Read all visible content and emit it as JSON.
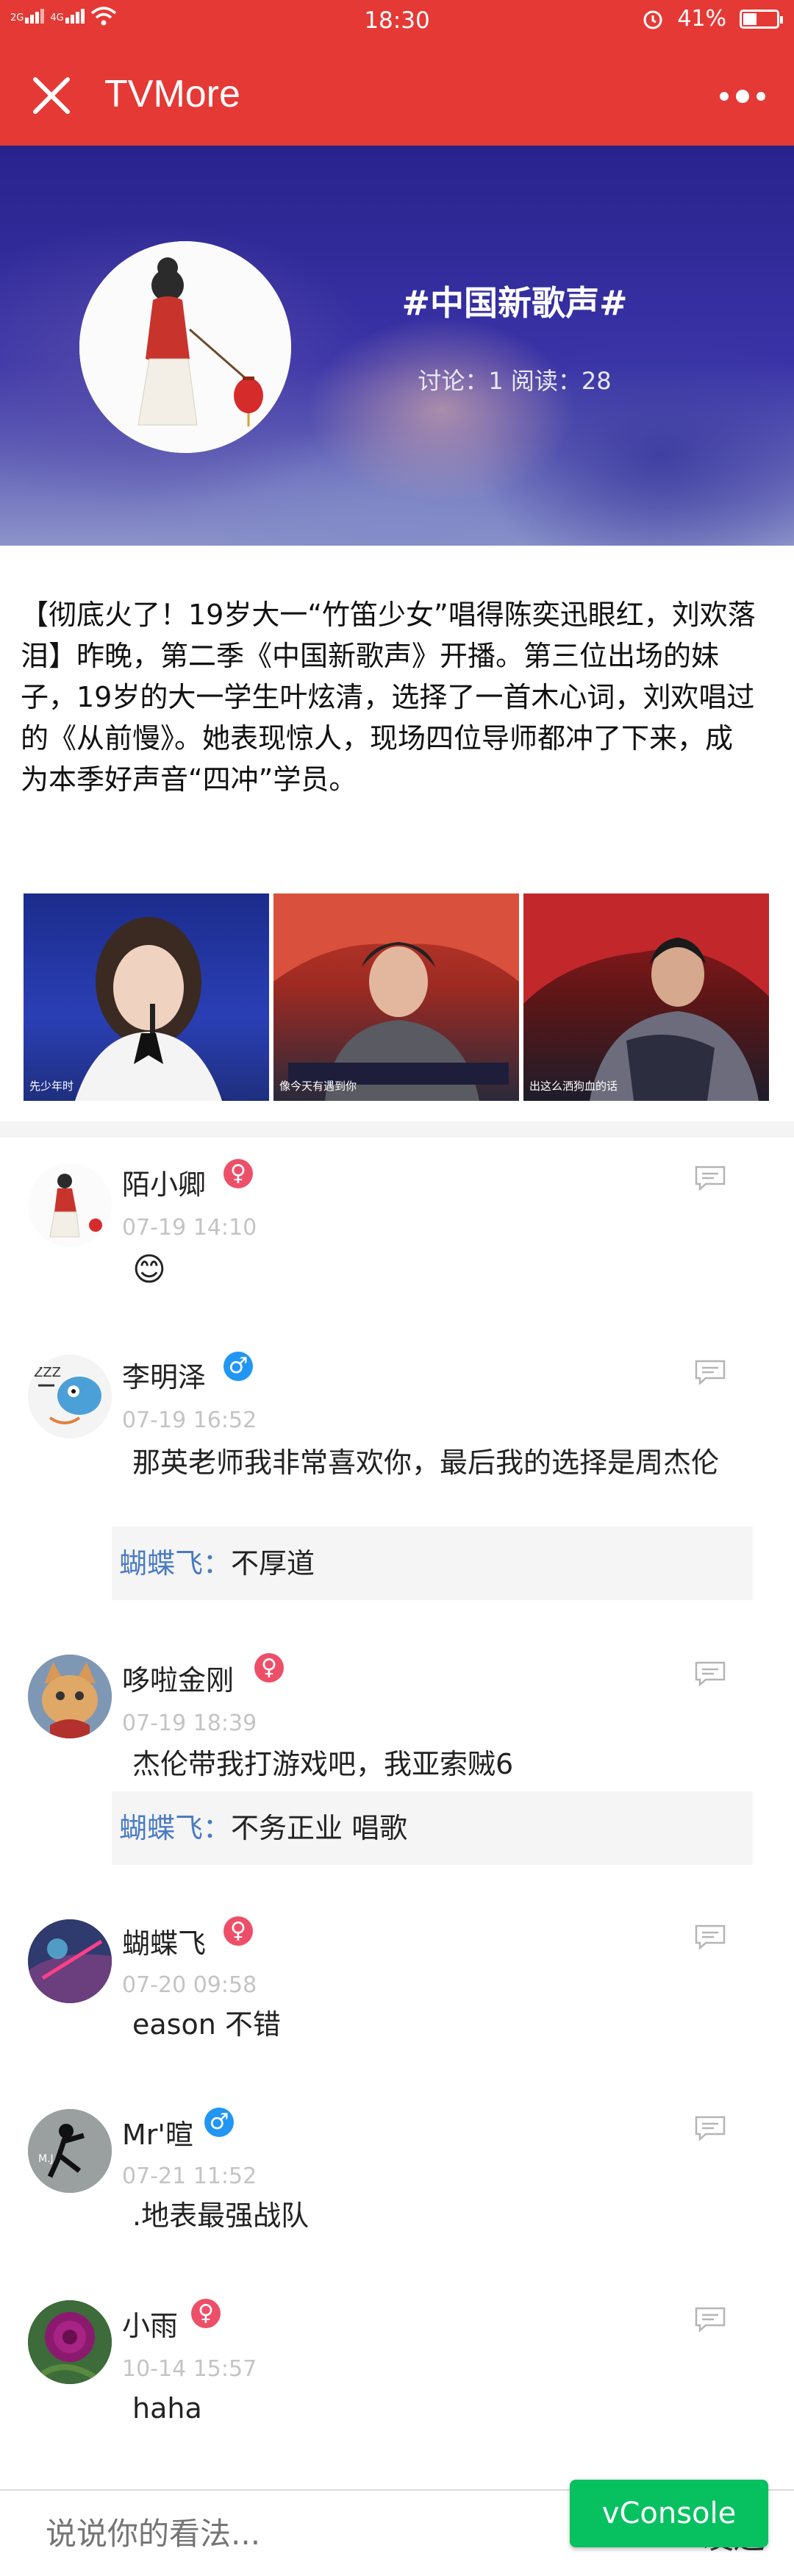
{
  "status_bar": {
    "signal_1": "2G",
    "signal_2": "4G",
    "time": "18:30",
    "battery": "41%",
    "battery_fraction": 0.41,
    "icons": [
      "signal-icon",
      "wifi-icon",
      "alarm-icon",
      "battery-icon"
    ]
  },
  "title_bar": {
    "title": "TVMore",
    "close_icon": "close-icon",
    "more_icon": "more-icon"
  },
  "topic": {
    "title": "#中国新歌声#",
    "stats": "讨论：1   阅读：28"
  },
  "article": {
    "text": "【彻底火了！19岁大一“竹笛少女”唱得陈奕迅眼红，刘欢落泪】昨晚，第二季《中国新歌声》开播。第三位出场的妹子，19岁的大一学生叶炫清，选择了一首木心词，刘欢唱过的《从前慢》。她表现惊人，现场四位导师都冲了下来，成为本季好声音“四冲”学员。",
    "photos": [
      {
        "caption": "先少年时"
      },
      {
        "caption": "像今天有遇到你"
      },
      {
        "caption": "出这么洒狗血的话"
      }
    ]
  },
  "comments": [
    {
      "name": "陌小卿",
      "gender": "♀",
      "time": "07-19 14:10",
      "text": "😊",
      "reply": null
    },
    {
      "name": "李明泽",
      "gender": "♂",
      "time": "07-19 16:52",
      "text": "那英老师我非常喜欢你，最后我的选择是周杰伦",
      "reply": {
        "name": "蝴蝶飞：",
        "text": "不厚道"
      }
    },
    {
      "name": "哆啦金刚",
      "gender": "♀",
      "time": "07-19 18:39",
      "text": "杰伦带我打游戏吧，我亚索贼6",
      "reply": {
        "name": "蝴蝶飞：",
        "text": "不务正业 唱歌"
      }
    },
    {
      "name": "蝴蝶飞",
      "gender": "♀",
      "time": "07-20 09:58",
      "text": "eason 不错",
      "reply": null
    },
    {
      "name": "Mr'暄",
      "gender": "♂",
      "time": "07-21 11:52",
      "text": ".地表最强战队",
      "reply": null
    },
    {
      "name": "小雨",
      "gender": "♀",
      "time": "10-14 15:57",
      "text": "haha",
      "reply": null
    }
  ],
  "bottom_bar": {
    "placeholder": "说说你的看法...",
    "send_label": "发送",
    "vconsole_label": "vConsole"
  },
  "colors": {
    "brand_red": "#e53935",
    "female": "#ee4f68",
    "male": "#2196f3",
    "reply_name": "#4a7bc4",
    "vconsole_green": "#07c160"
  }
}
